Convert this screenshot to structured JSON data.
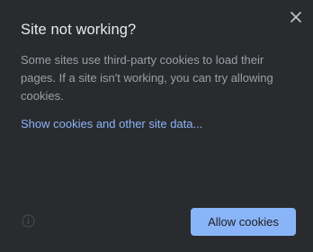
{
  "dialog": {
    "title": "Site not working?",
    "body": "Some sites use third-party cookies to load their pages. If a site isn't working, you can try allowing cookies.",
    "link_text": "Show cookies and other site data...",
    "allow_button_label": "Allow cookies",
    "icons": {
      "close": "close-icon",
      "info": "info-icon"
    },
    "colors": {
      "background": "#2a2b2e",
      "title": "#e8eaed",
      "body_text": "#9aa0a6",
      "link": "#8ab4f8",
      "button_bg": "#8ab4f8",
      "button_text": "#202124"
    }
  }
}
